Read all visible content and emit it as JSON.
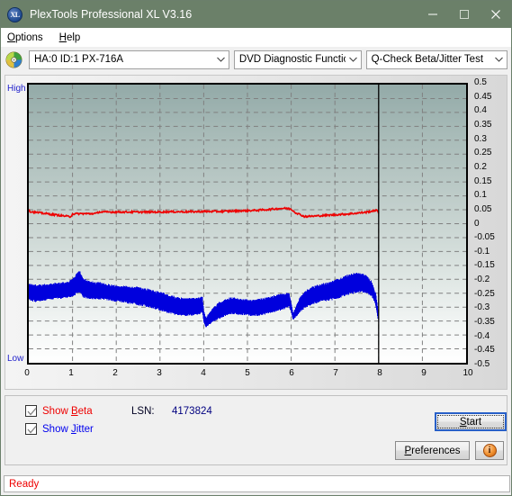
{
  "window": {
    "title": "PlexTools Professional XL V3.16",
    "app_icon": "xl-disc-icon",
    "minimize_label": "—",
    "maximize_label": "□",
    "close_label": "✕",
    "titlebar_color": "#6b8069"
  },
  "menu": {
    "items": [
      {
        "label": "Options",
        "accel": "O"
      },
      {
        "label": "Help",
        "accel": "H"
      }
    ]
  },
  "toolbar": {
    "drive_icon": "disc-icon",
    "drive": "HA:0 ID:1  PX-716A",
    "function": "DVD Diagnostic Functions",
    "test": "Q-Check Beta/Jitter Test",
    "arrow": "∨"
  },
  "chart": {
    "axis_high_label": "High",
    "axis_low_label": "Low",
    "beta_color": "#ee0000",
    "jitter_color": "#0000dd",
    "marker_color": "#000000"
  },
  "chart_data": {
    "type": "line",
    "title": "Q-Check Beta/Jitter Test",
    "xlabel": "",
    "ylabel": "",
    "xlim": [
      0,
      10
    ],
    "ylim": [
      -0.5,
      0.5
    ],
    "grid": true,
    "x_ticks": [
      0,
      1,
      2,
      3,
      4,
      5,
      6,
      7,
      8,
      9,
      10
    ],
    "x_tick_labels": [
      "0",
      "1",
      "2",
      "3",
      "4",
      "5",
      "6",
      "7",
      "8",
      "9",
      "10"
    ],
    "y_ticks": [
      0.5,
      0.45,
      0.4,
      0.35,
      0.3,
      0.25,
      0.2,
      0.15,
      0.1,
      0.05,
      0,
      -0.05,
      -0.1,
      -0.15,
      -0.2,
      -0.25,
      -0.3,
      -0.35,
      -0.4,
      -0.45,
      -0.5
    ],
    "y_tick_labels": [
      "0.5",
      "0.45",
      "0.4",
      "0.35",
      "0.3",
      "0.25",
      "0.2",
      "0.15",
      "0.1",
      "0.05",
      "0",
      "-0.05",
      "-0.1",
      "-0.15",
      "-0.2",
      "-0.25",
      "-0.3",
      "-0.35",
      "-0.4",
      "-0.45",
      "-0.5"
    ],
    "data_end_x": 8,
    "legend": [
      "Show Beta",
      "Show Jitter"
    ],
    "series": [
      {
        "name": "Beta",
        "color": "#ee0000",
        "x": [
          0.0,
          0.1,
          0.2,
          0.3,
          0.4,
          0.5,
          0.6,
          0.7,
          0.8,
          0.9,
          0.95,
          1.0,
          1.2,
          1.4,
          1.55,
          1.6,
          1.8,
          2.0,
          2.2,
          2.4,
          2.6,
          2.8,
          3.0,
          3.2,
          3.4,
          3.6,
          3.8,
          3.95,
          4.0,
          4.2,
          4.4,
          4.6,
          4.8,
          5.0,
          5.2,
          5.4,
          5.6,
          5.8,
          5.9,
          5.95,
          6.0,
          6.1,
          6.3,
          6.5,
          6.7,
          6.9,
          7.1,
          7.3,
          7.5,
          7.7,
          7.85,
          7.92,
          7.95,
          8.0
        ],
        "values": [
          0.045,
          0.042,
          0.04,
          0.038,
          0.036,
          0.034,
          0.032,
          0.03,
          0.028,
          0.026,
          0.025,
          0.035,
          0.036,
          0.036,
          0.037,
          0.042,
          0.042,
          0.042,
          0.042,
          0.042,
          0.042,
          0.042,
          0.042,
          0.043,
          0.043,
          0.043,
          0.043,
          0.044,
          0.044,
          0.044,
          0.044,
          0.045,
          0.046,
          0.047,
          0.048,
          0.05,
          0.053,
          0.055,
          0.055,
          0.054,
          0.052,
          0.04,
          0.026,
          0.027,
          0.029,
          0.031,
          0.033,
          0.035,
          0.038,
          0.041,
          0.045,
          0.048,
          0.049,
          0.038
        ]
      },
      {
        "name": "Jitter",
        "color": "#0000dd",
        "x": [
          0.0,
          0.15,
          0.3,
          0.45,
          0.6,
          0.75,
          0.9,
          1.05,
          1.15,
          1.25,
          1.35,
          1.5,
          1.65,
          1.8,
          1.95,
          2.1,
          2.25,
          2.4,
          2.55,
          2.7,
          2.85,
          3.0,
          3.15,
          3.3,
          3.45,
          3.6,
          3.75,
          3.9,
          3.97,
          4.0,
          4.05,
          4.2,
          4.35,
          4.5,
          4.65,
          4.8,
          4.95,
          5.1,
          5.25,
          5.4,
          5.55,
          5.7,
          5.85,
          5.95,
          6.0,
          6.05,
          6.2,
          6.35,
          6.5,
          6.65,
          6.8,
          6.95,
          7.1,
          7.25,
          7.4,
          7.55,
          7.7,
          7.85,
          7.93,
          7.97,
          8.0
        ],
        "center": [
          -0.245,
          -0.25,
          -0.248,
          -0.245,
          -0.242,
          -0.24,
          -0.238,
          -0.225,
          -0.205,
          -0.23,
          -0.238,
          -0.24,
          -0.242,
          -0.246,
          -0.25,
          -0.252,
          -0.255,
          -0.258,
          -0.262,
          -0.266,
          -0.272,
          -0.278,
          -0.285,
          -0.292,
          -0.298,
          -0.3,
          -0.298,
          -0.295,
          -0.29,
          -0.335,
          -0.355,
          -0.33,
          -0.312,
          -0.3,
          -0.295,
          -0.298,
          -0.3,
          -0.303,
          -0.3,
          -0.296,
          -0.29,
          -0.285,
          -0.278,
          -0.272,
          -0.3,
          -0.335,
          -0.29,
          -0.268,
          -0.258,
          -0.25,
          -0.245,
          -0.24,
          -0.232,
          -0.222,
          -0.215,
          -0.212,
          -0.216,
          -0.235,
          -0.27,
          -0.31,
          -0.345
        ],
        "halfwidth": [
          0.03,
          0.032,
          0.03,
          0.029,
          0.03,
          0.031,
          0.03,
          0.035,
          0.04,
          0.036,
          0.033,
          0.032,
          0.031,
          0.03,
          0.03,
          0.031,
          0.032,
          0.033,
          0.033,
          0.034,
          0.034,
          0.035,
          0.035,
          0.034,
          0.033,
          0.032,
          0.032,
          0.031,
          0.03,
          0.022,
          0.018,
          0.026,
          0.03,
          0.032,
          0.031,
          0.03,
          0.029,
          0.03,
          0.031,
          0.031,
          0.03,
          0.03,
          0.029,
          0.026,
          0.018,
          0.012,
          0.028,
          0.032,
          0.033,
          0.033,
          0.034,
          0.035,
          0.036,
          0.037,
          0.038,
          0.037,
          0.034,
          0.028,
          0.02,
          0.014,
          0.01
        ]
      }
    ]
  },
  "controls": {
    "show_beta": {
      "label_pre": "Show ",
      "label_accel": "B",
      "label_post": "eta",
      "checked": true
    },
    "show_jitter": {
      "label_pre": "Show ",
      "label_accel": "J",
      "label_post": "itter",
      "checked": true
    },
    "lsn_label": "LSN:",
    "lsn_value": "4173824",
    "start": {
      "pre": "",
      "accel": "S",
      "post": "tart"
    },
    "preferences": {
      "pre": "",
      "accel": "P",
      "post": "references"
    },
    "info_icon": "info-icon",
    "info_glyph": "i"
  },
  "status": {
    "text": "Ready",
    "color": "#ee0000"
  }
}
